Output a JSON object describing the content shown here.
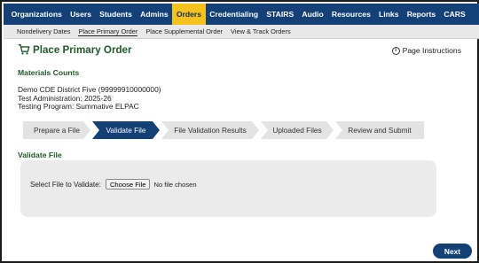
{
  "topnav": {
    "items": [
      "Organizations",
      "Users",
      "Students",
      "Admins",
      "Orders",
      "Credentialing",
      "STAIRS",
      "Audio",
      "Resources",
      "Links",
      "Reports",
      "CARS"
    ],
    "active_index": 4
  },
  "subnav": {
    "items": [
      "Nondelivery Dates",
      "Place Primary Order",
      "Place Supplemental Order",
      "View & Track Orders"
    ],
    "active_index": 1
  },
  "page": {
    "title": "Place Primary Order",
    "instructions_link": "Page Instructions",
    "cart_icon": "cart-icon",
    "info_icon": "info-icon"
  },
  "materials": {
    "heading": "Materials Counts",
    "district": "Demo CDE District Five (99999910000000)",
    "administration": "Test Administration: 2025-26",
    "program": "Testing Program: Summative ELPAC"
  },
  "stepper": {
    "steps": [
      "Prepare a File",
      "Validate File",
      "File Validation Results",
      "Uploaded Files",
      "Review and Submit"
    ],
    "active_index": 1
  },
  "validate": {
    "heading": "Validate File",
    "label": "Select File to Validate:",
    "button": "Choose File",
    "status": "No file chosen"
  },
  "actions": {
    "next": "Next"
  },
  "colors": {
    "nav_bg": "#124077",
    "nav_active": "#f7c21c",
    "heading_green": "#1f5a2a",
    "step_active": "#124077",
    "step_inactive": "#e3e3e3"
  }
}
